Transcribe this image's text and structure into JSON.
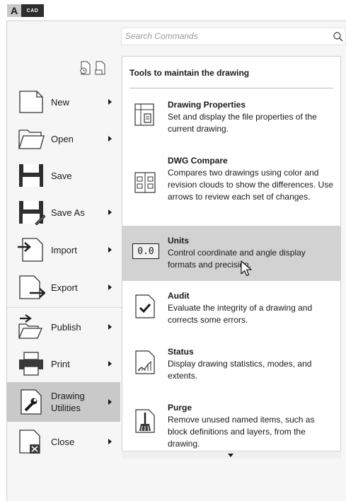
{
  "logo": {
    "letter": "A",
    "badge": "CAD"
  },
  "search": {
    "placeholder": "Search Commands",
    "icon": "search-icon"
  },
  "recent_icons": [
    "recent-documents-icon",
    "open-documents-icon"
  ],
  "menu": {
    "items": [
      {
        "label": "New",
        "icon": "new-document-icon",
        "has_submenu": true
      },
      {
        "label": "Open",
        "icon": "folder-open-icon",
        "has_submenu": true
      },
      {
        "label": "Save",
        "icon": "floppy-disk-icon",
        "has_submenu": false
      },
      {
        "label": "Save As",
        "icon": "save-as-icon",
        "has_submenu": true
      },
      {
        "label": "Import",
        "icon": "import-icon",
        "has_submenu": true
      },
      {
        "label": "Export",
        "icon": "export-icon",
        "has_submenu": true
      },
      {
        "label": "Publish",
        "icon": "publish-icon",
        "has_submenu": true
      },
      {
        "label": "Print",
        "icon": "printer-icon",
        "has_submenu": true
      },
      {
        "label": "Drawing Utilities",
        "icon": "wrench-icon",
        "has_submenu": true,
        "active": true
      },
      {
        "label": "Close",
        "icon": "close-document-icon",
        "has_submenu": true
      }
    ]
  },
  "panel": {
    "title": "Tools to maintain the drawing",
    "tools": [
      {
        "title": "Drawing Properties",
        "description": "Set and display the file properties of the current drawing.",
        "icon": "drawing-properties-icon"
      },
      {
        "title": "DWG Compare",
        "description": "Compares two drawings using color and revision clouds to show the differences. Use arrows to review each set of changes.",
        "icon": "dwg-compare-icon"
      },
      {
        "title": "Units",
        "description": "Control coordinate and angle display formats and precision.",
        "icon_text": "0.0",
        "active": true
      },
      {
        "title": "Audit",
        "description": "Evaluate the integrity of a drawing and corrects some errors.",
        "icon": "audit-checkmark-icon"
      },
      {
        "title": "Status",
        "description": "Display drawing statistics, modes, and extents.",
        "icon": "status-chart-icon"
      },
      {
        "title": "Purge",
        "description": "Remove unused named items, such as block definitions and layers, from the drawing.",
        "icon": "purge-broom-icon"
      }
    ]
  },
  "colors": {
    "active_menu": "#c9c9c9",
    "active_tool": "#d2d2d2",
    "frame": "#f6f6f6"
  }
}
